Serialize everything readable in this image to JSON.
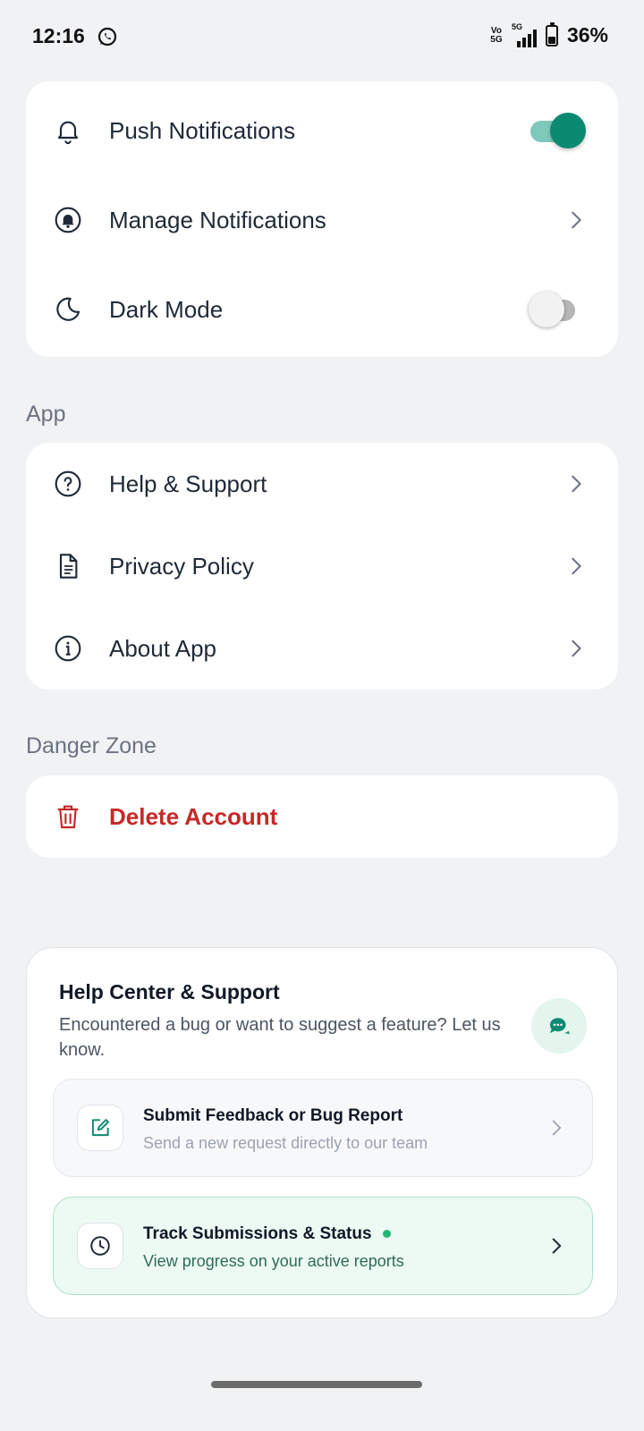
{
  "status_bar": {
    "time": "12:16",
    "volte": "Vo 5G",
    "network": "5G",
    "battery": "36%",
    "notification_icon": "whatsapp-icon"
  },
  "preferences": {
    "push_notifications": {
      "label": "Push Notifications",
      "icon": "bell-icon",
      "enabled": true
    },
    "manage_notifications": {
      "label": "Manage Notifications",
      "icon": "bell-circle-icon"
    },
    "dark_mode": {
      "label": "Dark Mode",
      "icon": "moon-icon",
      "enabled": false
    }
  },
  "app_section": {
    "title": "App",
    "items": [
      {
        "label": "Help & Support",
        "icon": "question-circle-icon"
      },
      {
        "label": "Privacy Policy",
        "icon": "document-icon"
      },
      {
        "label": "About App",
        "icon": "info-circle-icon"
      }
    ]
  },
  "danger_section": {
    "title": "Danger Zone",
    "delete_label": "Delete Account",
    "icon": "trash-icon"
  },
  "help_center": {
    "title": "Help Center & Support",
    "description": "Encountered a bug or want to suggest a feature? Let us know.",
    "chat_icon": "chat-bubble-icon",
    "options": [
      {
        "title": "Submit Feedback or Bug Report",
        "subtitle": "Send a new request directly to our team",
        "icon": "edit-icon"
      },
      {
        "title": "Track Submissions & Status",
        "subtitle": "View progress on your active reports",
        "icon": "clock-icon",
        "has_indicator": true
      }
    ]
  },
  "colors": {
    "accent": "#0b8a72",
    "danger": "#c62828",
    "background": "#f1f2f4"
  }
}
